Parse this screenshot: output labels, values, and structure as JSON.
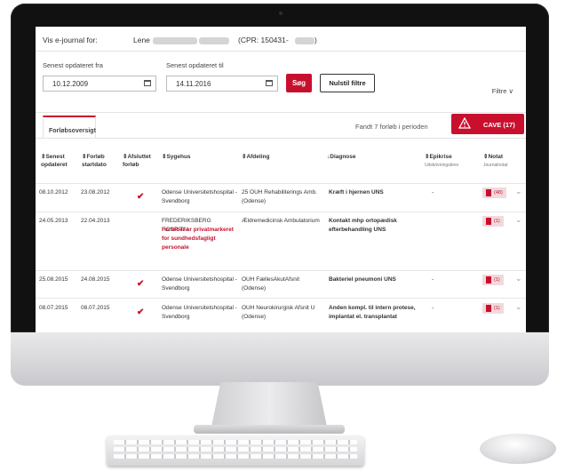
{
  "header": {
    "vis_label": "Vis e-journal for:",
    "first_name": "Lene",
    "cpr_prefix": "(CPR: 150431-"
  },
  "filter": {
    "from_label": "Senest opdateret fra",
    "from_value": "10.12.2009",
    "to_label": "Senest opdateret til",
    "to_value": "14.11.2016",
    "search_label": "Søg",
    "reset_label": "Nulstil filtre",
    "filters_label": "Filtre ∨"
  },
  "tabs": {
    "overview_label": "Forløbsoversigt"
  },
  "summary": {
    "found_text": "Fandt 7 forløb i perioden",
    "cave_label": "CAVE (17)"
  },
  "columns": [
    {
      "label": "⇕Senest opdateret",
      "sub": ""
    },
    {
      "label": "⇕Forløb startdato",
      "sub": ""
    },
    {
      "label": "⇕Afsluttet forløb",
      "sub": ""
    },
    {
      "label": "⇕Sygehus",
      "sub": ""
    },
    {
      "label": "⇕Afdeling",
      "sub": ""
    },
    {
      "label": "↓Diagnose",
      "sub": ""
    },
    {
      "label": "⇕Epikrise",
      "sub": "Udskrivningsbrev"
    },
    {
      "label": "⇕Notat",
      "sub": "Journalnotat"
    }
  ],
  "rows": [
    {
      "updated": "08.10.2012",
      "start": "23.08.2012",
      "closed": true,
      "hospital": "Odense Universitetshospital - Svendborg",
      "hospital_note": "",
      "department": "25 OUH Rehabiliterings Amb. (Odense)",
      "diagnosis": "Kræft i hjernen UNS",
      "epikrise": "-",
      "notes": "(48)"
    },
    {
      "updated": "24.05.2013",
      "start": "22.04.2013",
      "closed": false,
      "hospital": "FREDERIKSBERG HOSPITAL",
      "hospital_note": "Forløbet er privatmarkeret for sundhedsfagligt personale",
      "department": "Ældremedicinsk Ambulatorium",
      "diagnosis": "Kontakt mhp ortopædisk efterbehandling UNS",
      "epikrise": "",
      "notes": "(1)"
    },
    {
      "updated": "25.08.2015",
      "start": "24.08.2015",
      "closed": true,
      "hospital": "Odense Universitetshospital - Svendborg",
      "hospital_note": "",
      "department": "OUH FællesAkutAfsnit (Odense)",
      "diagnosis": "Bakteriel pneumoni UNS",
      "epikrise": "-",
      "notes": "(1)"
    },
    {
      "updated": "08.07.2015",
      "start": "08.07.2015",
      "closed": true,
      "hospital": "Odense Universitetshospital - Svendborg",
      "hospital_note": "",
      "department": "OUH Neurokirurgisk Afsnit U (Odense)",
      "diagnosis": "Anden kompl. til intern protese, implantat el. transplantat",
      "epikrise": "-",
      "notes": "(1)"
    }
  ],
  "icons": {
    "calendar": "calendar-icon",
    "warning": "warning-triangle-icon",
    "note": "document-icon",
    "check": "checkmark-icon",
    "chevron": "chevron-down-icon"
  },
  "colors": {
    "accent": "#c8102e"
  }
}
